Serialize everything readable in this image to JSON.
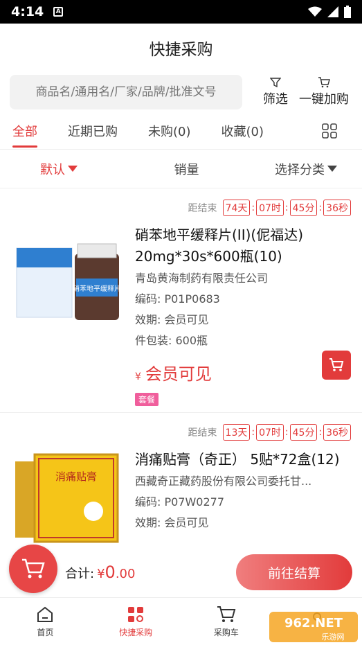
{
  "status": {
    "time": "4:14",
    "a_label": "A"
  },
  "header": {
    "title": "快捷采购"
  },
  "search": {
    "placeholder": "商品名/通用名/厂家/品牌/批准文号"
  },
  "tools": {
    "filter_label": "筛选",
    "quick_add_label": "一键加购"
  },
  "tabs": [
    {
      "label": "全部",
      "active": true
    },
    {
      "label": "近期已购"
    },
    {
      "label": "未购(0)"
    },
    {
      "label": "收藏(0)"
    }
  ],
  "sort": {
    "default_label": "默认",
    "sales_label": "销量",
    "category_label": "选择分类"
  },
  "products": [
    {
      "countdown_label": "距结束",
      "days": "74天",
      "hours": "07时",
      "minutes": "45分",
      "seconds": "36秒",
      "name": "硝苯地平缓释片(II)(伲福达) 20mg*30s*600瓶(10)",
      "company": "青岛黄海制药有限责任公司",
      "code": "编码: P01P0683",
      "expiry": "效期: 会员可见",
      "package": "件包装: 600瓶",
      "price_symbol": "¥",
      "price": "会员可见",
      "badge": "套餐",
      "image_text": "硝苯地平缓释片"
    },
    {
      "countdown_label": "距结束",
      "days": "13天",
      "hours": "07时",
      "minutes": "45分",
      "seconds": "36秒",
      "name": "消痛贴膏（奇正） 5贴*72盒(12)",
      "company": "西藏奇正藏药股份有限公司委托甘...",
      "code": "编码: P07W0277",
      "expiry": "效期: 会员可见",
      "image_text": "消痛贴膏"
    }
  ],
  "bottom": {
    "total_label": "合计:",
    "currency": "¥",
    "amount_int": "0",
    "amount_dec": ".00",
    "checkout_label": "前往结算"
  },
  "nav": [
    {
      "label": "首页"
    },
    {
      "label": "快捷采购",
      "active": true
    },
    {
      "label": "采购车"
    },
    {
      "label": ""
    }
  ],
  "watermark": {
    "text": "962.NET",
    "sub": "乐游网"
  },
  "colors": {
    "accent": "#e23b3b",
    "badge": "#f05e9c"
  }
}
